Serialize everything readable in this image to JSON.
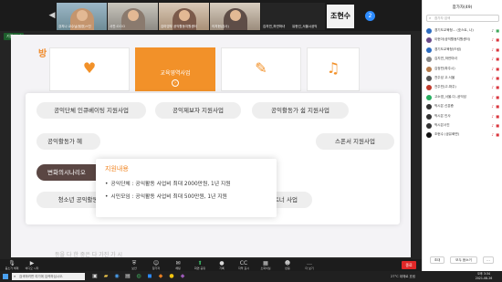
{
  "gallery": {
    "prev_icon": "chevron-left-icon",
    "next_label": "2",
    "tiles": [
      {
        "name": "강지나 교수님(팀장)+진"
      },
      {
        "name": "사진:ㅁㅁㅁ"
      },
      {
        "name": "김미영부 공익활동지원센터"
      },
      {
        "name": "이지현(강사)"
      },
      {
        "name": "김지연_하얀마녀"
      },
      {
        "name": "유현선_서울시공익"
      },
      {
        "name": "조현수"
      }
    ]
  },
  "share": {
    "label": "기원 보기",
    "cards": [
      {
        "icon": "heart-hand-icon",
        "label": ""
      },
      {
        "icon": "arrow-circle-icon",
        "label": "교육영역사업"
      },
      {
        "icon": "tools-icon",
        "label": ""
      },
      {
        "icon": "music-palette-icon",
        "label": ""
      }
    ],
    "pills": [
      "공익단체 인큐베이팅 지원사업",
      "공익제보자 지원사업",
      "공익활동가 쉼 지원사업",
      "공익활동가 혜",
      "스폰서 지원사업",
      "변화의시나리오",
      "청소년 공익활동 지원사업 - 나눔교육 X 유스펀치",
      "카카오같이가치 파트너 사업"
    ],
    "tooltip": {
      "title": "지원내용",
      "items": [
        "공익단체 : 공익활동 사업비 최대 2000만원, 1년 지원",
        "시민모임 : 공익활동 사업비 최대 500만원, 1년 지원"
      ]
    },
    "bottom_text": "등을 다 한 중은 다 가진 가 시"
  },
  "toolbar": {
    "buttons": [
      {
        "icon": "mic-icon",
        "label": "음소거 해제"
      },
      {
        "icon": "video-icon",
        "label": "비디오 시작"
      },
      {
        "icon": "shield-icon",
        "label": "보안"
      },
      {
        "icon": "people-icon",
        "label": "참가자"
      },
      {
        "icon": "chat-icon",
        "label": "채팅"
      },
      {
        "icon": "share-icon",
        "label": "화면 공유"
      },
      {
        "icon": "record-icon",
        "label": "기록"
      },
      {
        "icon": "caption-icon",
        "label": "자막 표시"
      },
      {
        "icon": "rooms-icon",
        "label": "소회의실"
      },
      {
        "icon": "reaction-icon",
        "label": "반응"
      },
      {
        "icon": "more-icon",
        "label": "더 보기"
      }
    ],
    "end_label": "종료"
  },
  "participants": {
    "title": "참가자(49)",
    "search_placeholder": "참가자 검색",
    "rows": [
      {
        "name": "경기도교육청... (호스트, 나)"
      },
      {
        "name": "이현아(공익활동지원센터)"
      },
      {
        "name": "경기도교육청(드림)"
      },
      {
        "name": "김지연_하얀마녀"
      },
      {
        "name": "김정민(파주시)"
      },
      {
        "name": "전주성 고.서울"
      },
      {
        "name": "전주민(고.파주)"
      },
      {
        "name": "고소영_서울.다..공익성"
      },
      {
        "name": "박시은 신분증"
      },
      {
        "name": "박시은 인사"
      },
      {
        "name": "박시은사진"
      },
      {
        "name": "조현수 (공유화면)"
      }
    ],
    "invite_label": "초대",
    "mute_all_label": "모두 음소거",
    "more_label": "..."
  },
  "taskbar": {
    "search_placeholder": "검색하려면 여기에 입력하십시오.",
    "weather": "27°C 대체로 흐림",
    "time": "오후 3:34",
    "date": "2021-08-26"
  }
}
